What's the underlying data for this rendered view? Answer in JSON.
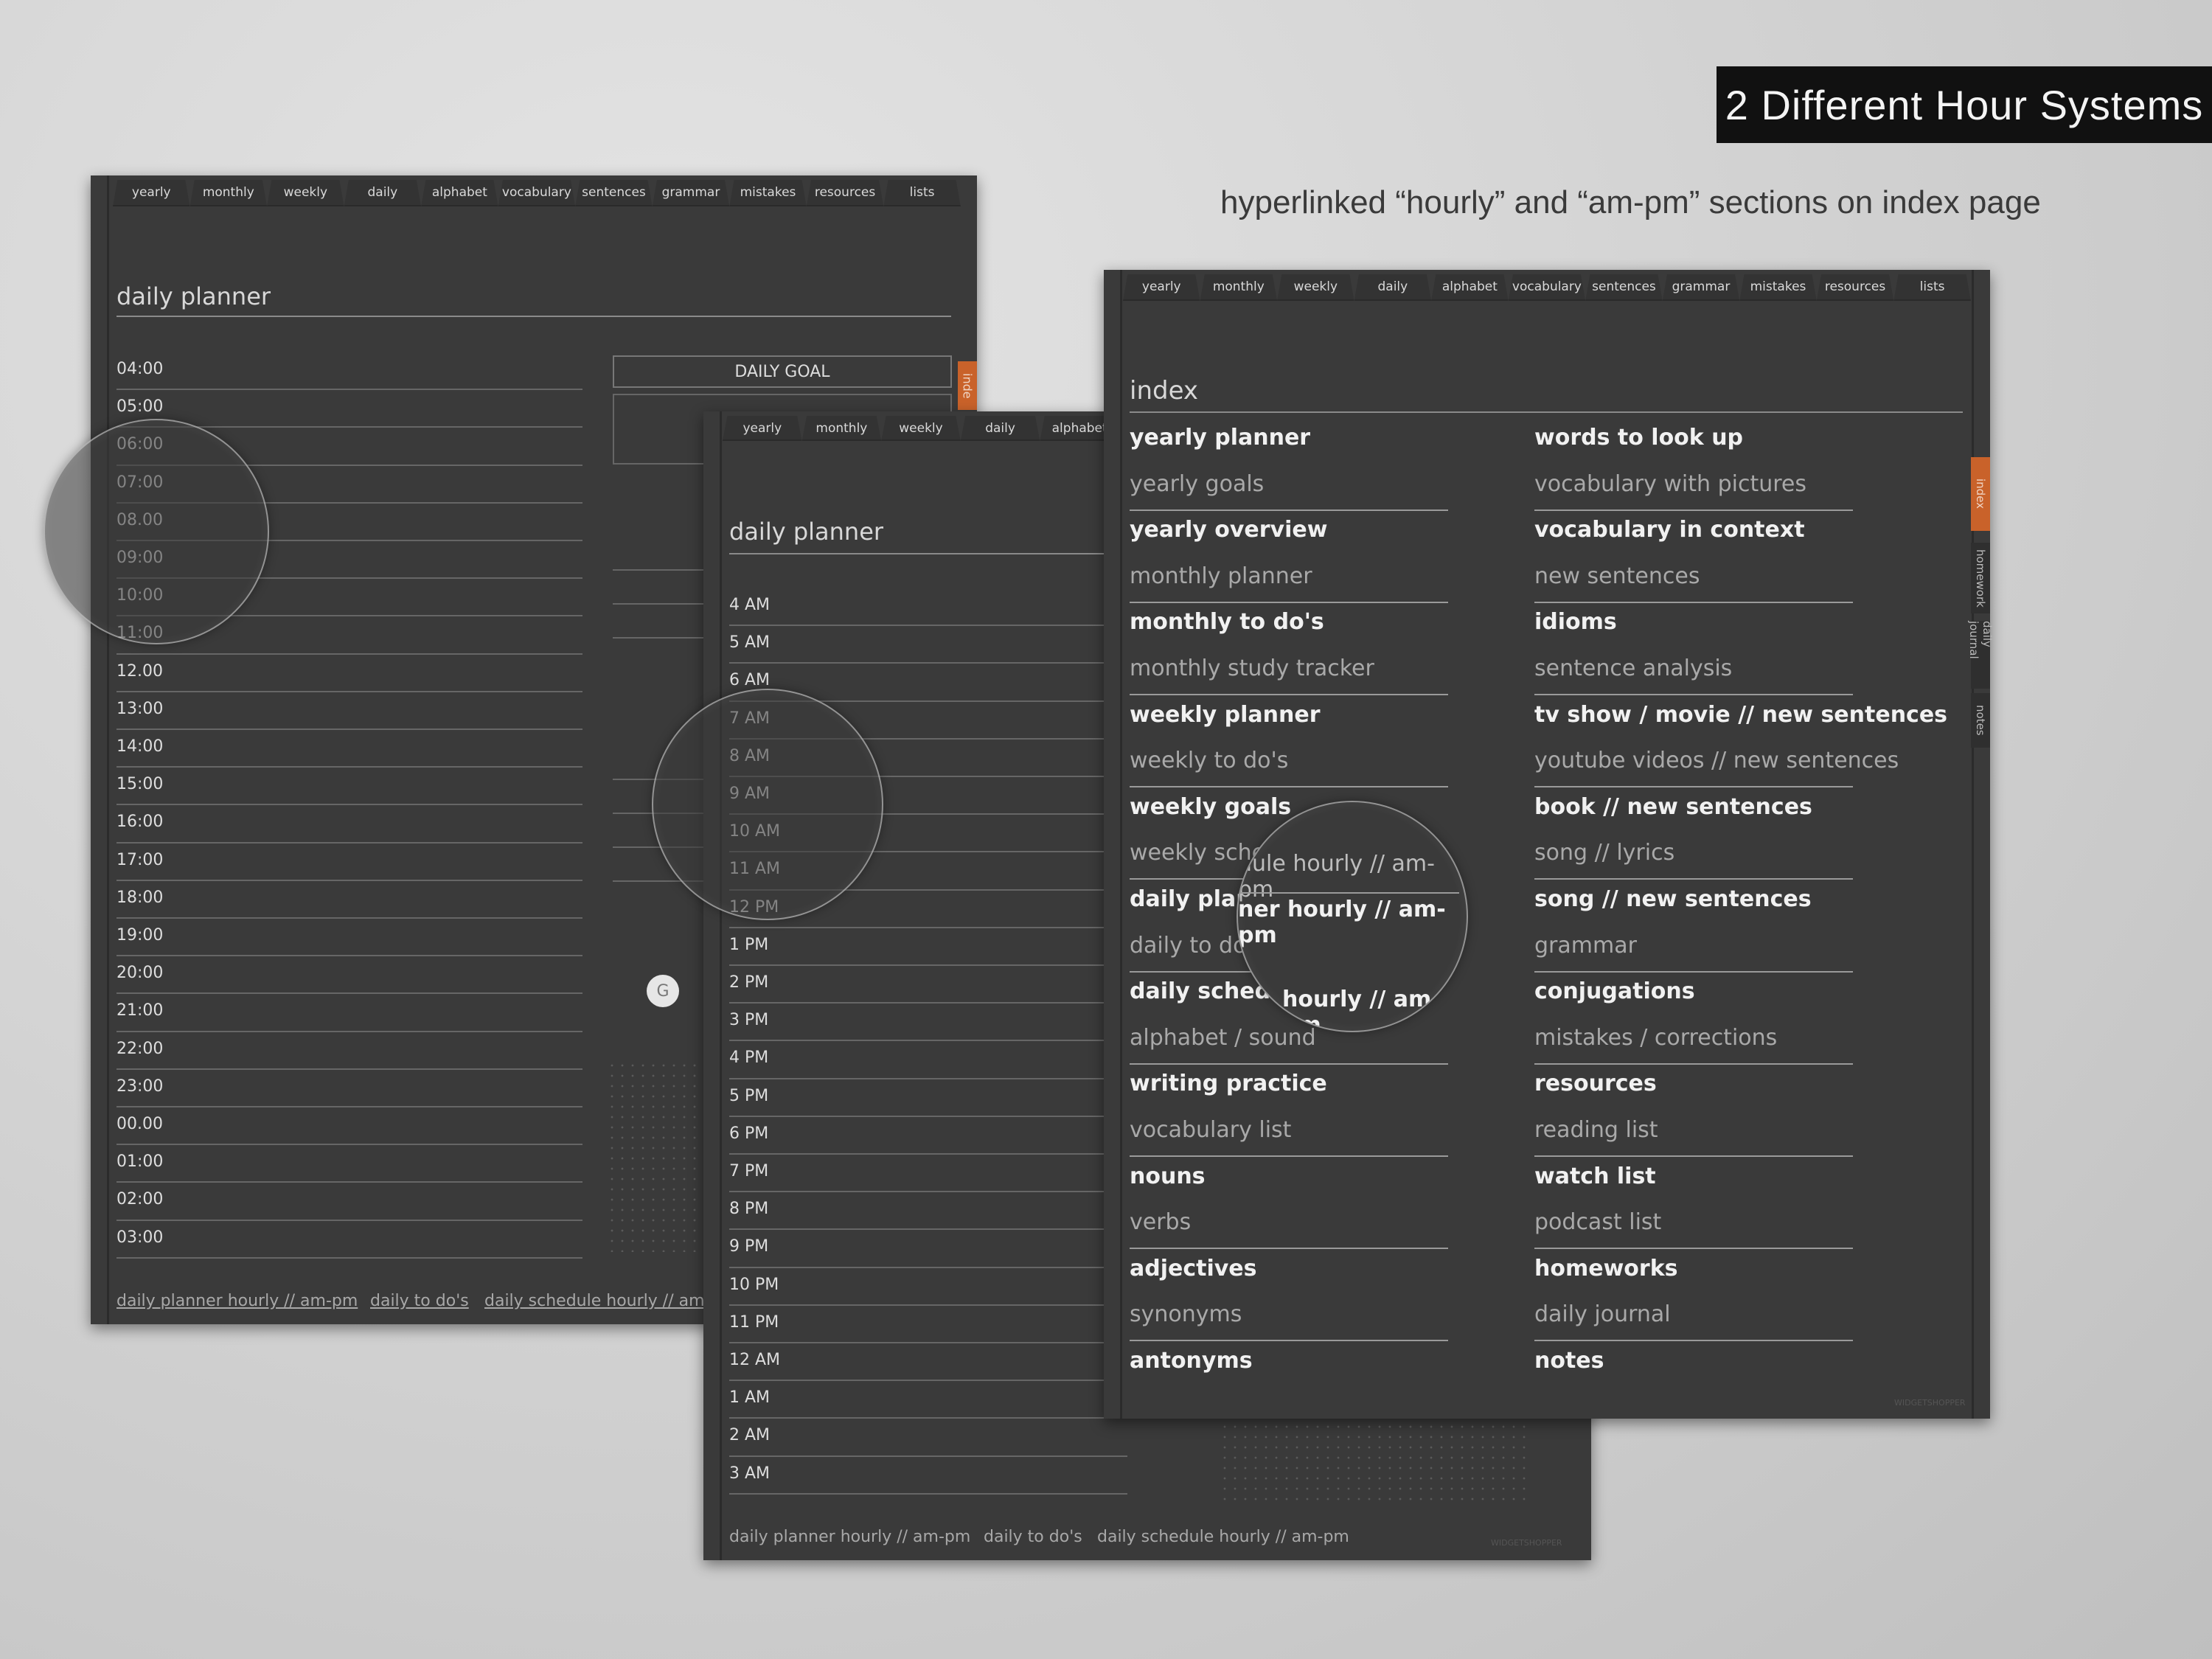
{
  "headline": "2 Different Hour Systems",
  "subline": "hyperlinked “hourly” and “am-pm” sections on index page",
  "nav_tabs": [
    "yearly",
    "monthly",
    "weekly",
    "daily",
    "alphabet",
    "vocabulary",
    "sentences",
    "grammar",
    "mistakes",
    "resources",
    "lists"
  ],
  "nav_tabs_short": [
    "yearly",
    "monthly",
    "weekly",
    "daily",
    "alphabet"
  ],
  "hourly_page": {
    "title": "daily planner",
    "hours": [
      "04:00",
      "05:00",
      "06:00",
      "07:00",
      "08.00",
      "09:00",
      "10:00",
      "11:00",
      "12.00",
      "13:00",
      "14:00",
      "15:00",
      "16:00",
      "17:00",
      "18:00",
      "19:00",
      "20:00",
      "21:00",
      "22:00",
      "23:00",
      "00.00",
      "01:00",
      "02:00",
      "03:00"
    ],
    "daily_goal_label": "DAILY GOAL",
    "side_tab": "inde",
    "circle_letter": "G",
    "footer": [
      "daily planner hourly // am-pm",
      "daily to do's",
      "daily schedule hourly // am-pm"
    ]
  },
  "ampm_page": {
    "title": "daily planner",
    "hours": [
      "4 AM",
      "5 AM",
      "6 AM",
      "7 AM",
      "8 AM",
      "9 AM",
      "10 AM",
      "11 AM",
      "12 PM",
      "1 PM",
      "2 PM",
      "3 PM",
      "4 PM",
      "5 PM",
      "6 PM",
      "7 PM",
      "8 PM",
      "9 PM",
      "10 PM",
      "11 PM",
      "12 AM",
      "1 AM",
      "2 AM",
      "3 AM"
    ],
    "footer": [
      "daily planner hourly // am-pm",
      "daily to do's",
      "daily schedule hourly // am-pm"
    ],
    "watermark": "WIDGETSHOPPER"
  },
  "index_page": {
    "title": "index",
    "left": [
      {
        "text": "yearly planner",
        "bold": true
      },
      {
        "text": "yearly goals",
        "bold": false
      },
      {
        "text": "yearly overview",
        "bold": true
      },
      {
        "text": "monthly planner",
        "bold": false
      },
      {
        "text": "monthly to do's",
        "bold": true
      },
      {
        "text": "monthly study tracker",
        "bold": false
      },
      {
        "text": "weekly planner",
        "bold": true
      },
      {
        "text": "weekly to do's",
        "bold": false
      },
      {
        "text": "weekly goals",
        "bold": true
      },
      {
        "text": "weekly sched",
        "bold": false
      },
      {
        "text": "daily plann",
        "bold": true
      },
      {
        "text": "daily to do's",
        "bold": false
      },
      {
        "text": "daily schedule",
        "bold": true
      },
      {
        "text": "alphabet / sound",
        "bold": false
      },
      {
        "text": "writing practice",
        "bold": true
      },
      {
        "text": "vocabulary list",
        "bold": false
      },
      {
        "text": "nouns",
        "bold": true
      },
      {
        "text": "verbs",
        "bold": false
      },
      {
        "text": "adjectives",
        "bold": true
      },
      {
        "text": "synonyms",
        "bold": false
      },
      {
        "text": "antonyms",
        "bold": true
      }
    ],
    "right": [
      {
        "text": "words to look up",
        "bold": true
      },
      {
        "text": "vocabulary with pictures",
        "bold": false
      },
      {
        "text": "vocabulary in context",
        "bold": true
      },
      {
        "text": "new sentences",
        "bold": false
      },
      {
        "text": "idioms",
        "bold": true
      },
      {
        "text": "sentence analysis",
        "bold": false
      },
      {
        "text": "tv show / movie // new sentences",
        "bold": true
      },
      {
        "text": "youtube videos // new sentences",
        "bold": false
      },
      {
        "text": "book // new sentences",
        "bold": true
      },
      {
        "text": "song // lyrics",
        "bold": false
      },
      {
        "text": "song // new sentences",
        "bold": true
      },
      {
        "text": "grammar",
        "bold": false
      },
      {
        "text": "conjugations",
        "bold": true
      },
      {
        "text": "mistakes / corrections",
        "bold": false
      },
      {
        "text": "resources",
        "bold": true
      },
      {
        "text": "reading list",
        "bold": false
      },
      {
        "text": "watch list",
        "bold": true
      },
      {
        "text": "podcast list",
        "bold": false
      },
      {
        "text": "homeworks",
        "bold": true
      },
      {
        "text": "daily journal",
        "bold": false
      },
      {
        "text": "notes",
        "bold": true
      }
    ],
    "magnifier_lines": [
      "dule hourly // am-pm",
      "ner hourly // am-pm",
      "hourly // am-pm"
    ],
    "side_tabs": [
      "index",
      "homework",
      "daily journal",
      "notes"
    ],
    "watermark": "WIDGETSHOPPER"
  }
}
